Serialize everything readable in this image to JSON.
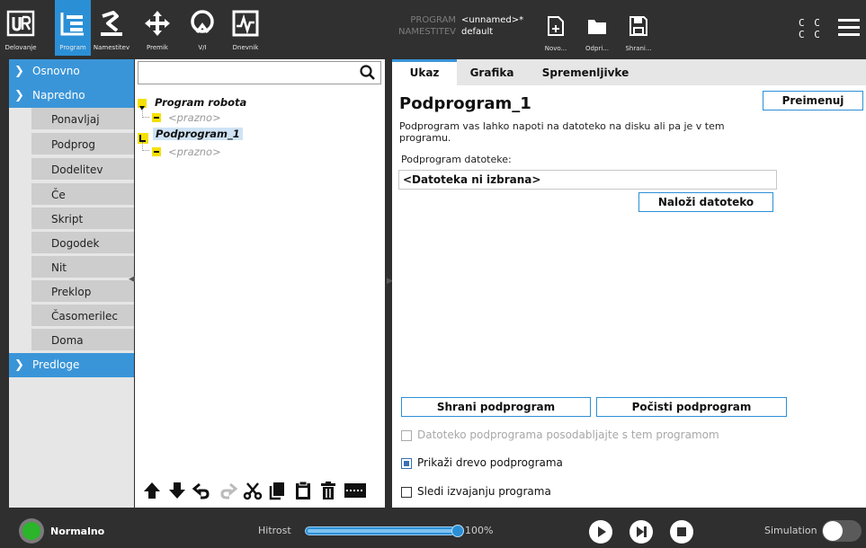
{
  "nav": [
    {
      "label": "Delovanje",
      "icon": "ur-logo-icon"
    },
    {
      "label": "Program",
      "icon": "program-icon"
    },
    {
      "label": "Namestitev",
      "icon": "installation-icon"
    },
    {
      "label": "Premik",
      "icon": "move-icon"
    },
    {
      "label": "V/I",
      "icon": "io-icon"
    },
    {
      "label": "Dnevnik",
      "icon": "log-icon"
    }
  ],
  "header_info": {
    "program_key": "PROGRAM",
    "program_value": "<unnamed>*",
    "install_key": "NAMESTITEV",
    "install_value": "default"
  },
  "file_buttons": [
    {
      "label": "Novo..."
    },
    {
      "label": "Odpri..."
    },
    {
      "label": "Shrani..."
    }
  ],
  "cc_text": [
    "C C",
    "C C"
  ],
  "categories": {
    "basic": "Osnovno",
    "advanced": "Napredno",
    "templates": "Predloge"
  },
  "advanced_items": [
    "Ponavljaj",
    "Podprog",
    "Dodelitev",
    "Če",
    "Skript",
    "Dogodek",
    "Nit",
    "Preklop",
    "Časomerilec",
    "Doma"
  ],
  "tree": {
    "root": "Program robota",
    "root_child": "<prazno>",
    "sub": "Podprogram_1",
    "sub_child": "<prazno>"
  },
  "tabs": [
    "Ukaz",
    "Grafika",
    "Spremenljivke"
  ],
  "content": {
    "title": "Podprogram_1",
    "rename_button": "Preimenuj",
    "description": "Podprogram vas lahko napoti na datoteko na disku ali pa je v tem programu.",
    "file_label": "Podprogram datoteke:",
    "file_value": "<Datoteka ni izbrana>",
    "load_button": "Naloži datoteko",
    "save_button": "Shrani podprogram",
    "clear_button": "Počisti podprogram",
    "checkboxes": [
      {
        "label": "Datoteko podprograma posodabljajte s tem programom",
        "checked": false,
        "disabled": true
      },
      {
        "label": "Prikaži drevo podprograma",
        "checked": true,
        "disabled": false
      },
      {
        "label": "Sledi izvajanju programa",
        "checked": false,
        "disabled": false
      }
    ]
  },
  "footer": {
    "status": "Normalno",
    "speed_label": "Hitrost",
    "speed_value": "100%",
    "speed_fraction": 1.0,
    "simulation_label": "Simulation"
  },
  "colors": {
    "accent": "#2b8fd6",
    "status_ok": "#2ab52a",
    "tree_highlight": "#f5e000"
  }
}
